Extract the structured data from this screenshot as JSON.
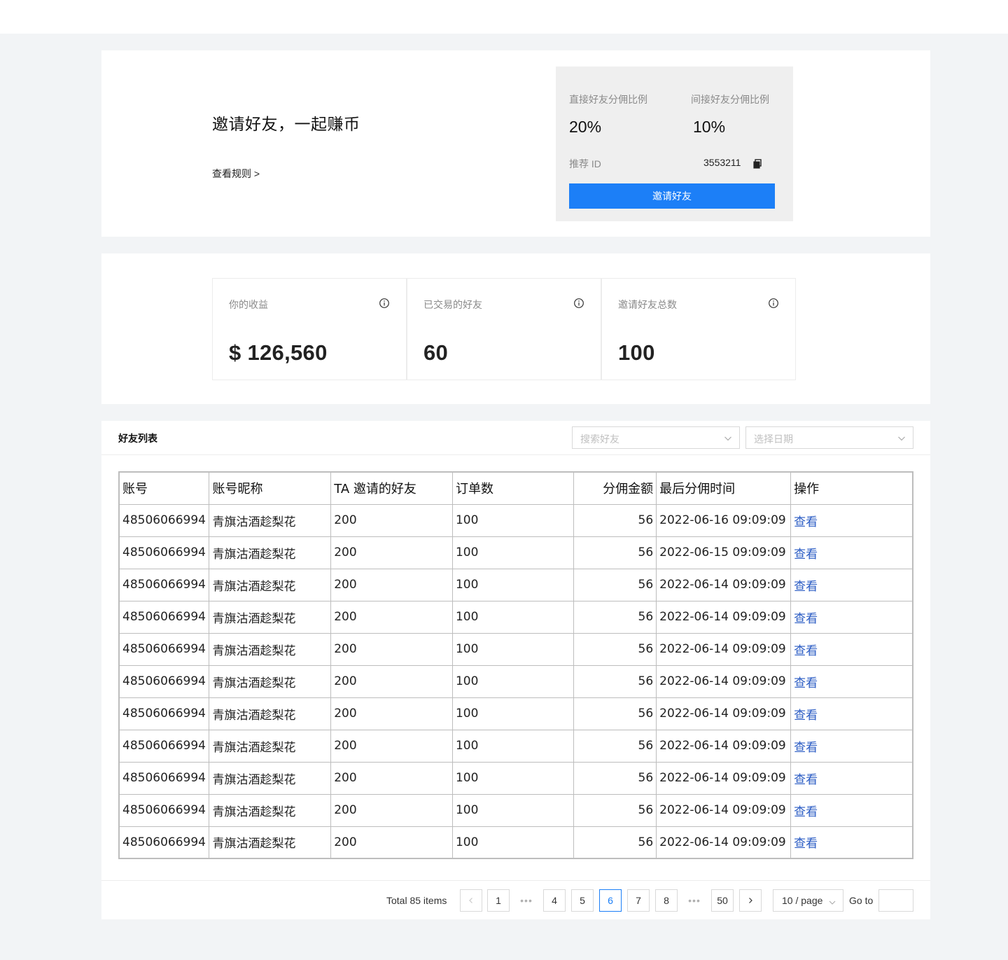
{
  "hero": {
    "title": "邀请好友，一起赚币",
    "rules_link": "查看规则 >",
    "direct_label": "直接好友分佣比例",
    "direct_rate": "20%",
    "indirect_label": "间接好友分佣比例",
    "indirect_rate": "10%",
    "ref_label": "推荐 ID",
    "ref_id": "3553211",
    "invite_button": "邀请好友"
  },
  "stats": [
    {
      "label": "你的收益",
      "value": "$ 126,560"
    },
    {
      "label": "已交易的好友",
      "value": "60"
    },
    {
      "label": "邀请好友总数",
      "value": "100"
    }
  ],
  "list": {
    "title": "好友列表",
    "search_placeholder": "搜索好友",
    "date_placeholder": "选择日期"
  },
  "table": {
    "columns": [
      "账号",
      "账号昵称",
      "TA 邀请的好友",
      "订单数",
      "分佣金额",
      "最后分佣时间",
      "操作"
    ],
    "rows": [
      [
        "48506066994",
        "青旗沽酒趁梨花",
        "200",
        "100",
        "56",
        "2022-06-16 09:09:09",
        "查看"
      ],
      [
        "48506066994",
        "青旗沽酒趁梨花",
        "200",
        "100",
        "56",
        "2022-06-15 09:09:09",
        "查看"
      ],
      [
        "48506066994",
        "青旗沽酒趁梨花",
        "200",
        "100",
        "56",
        "2022-06-14 09:09:09",
        "查看"
      ],
      [
        "48506066994",
        "青旗沽酒趁梨花",
        "200",
        "100",
        "56",
        "2022-06-14 09:09:09",
        "查看"
      ],
      [
        "48506066994",
        "青旗沽酒趁梨花",
        "200",
        "100",
        "56",
        "2022-06-14 09:09:09",
        "查看"
      ],
      [
        "48506066994",
        "青旗沽酒趁梨花",
        "200",
        "100",
        "56",
        "2022-06-14 09:09:09",
        "查看"
      ],
      [
        "48506066994",
        "青旗沽酒趁梨花",
        "200",
        "100",
        "56",
        "2022-06-14 09:09:09",
        "查看"
      ],
      [
        "48506066994",
        "青旗沽酒趁梨花",
        "200",
        "100",
        "56",
        "2022-06-14 09:09:09",
        "查看"
      ],
      [
        "48506066994",
        "青旗沽酒趁梨花",
        "200",
        "100",
        "56",
        "2022-06-14 09:09:09",
        "查看"
      ],
      [
        "48506066994",
        "青旗沽酒趁梨花",
        "200",
        "100",
        "56",
        "2022-06-14 09:09:09",
        "查看"
      ],
      [
        "48506066994",
        "青旗沽酒趁梨花",
        "200",
        "100",
        "56",
        "2022-06-14 09:09:09",
        "查看"
      ]
    ]
  },
  "pagination": {
    "total": "Total 85 items",
    "pages": [
      "1",
      "4",
      "5",
      "6",
      "7",
      "8",
      "50"
    ],
    "current": "6",
    "ellipsis": "•••",
    "page_size": "10 / page",
    "goto_label": "Go to",
    "goto_value": ""
  },
  "colors": {
    "accent": "#1c7ff7",
    "link": "#2b5cc4",
    "page_bg": "#f2f4f6",
    "card_bg": "#efefef"
  }
}
